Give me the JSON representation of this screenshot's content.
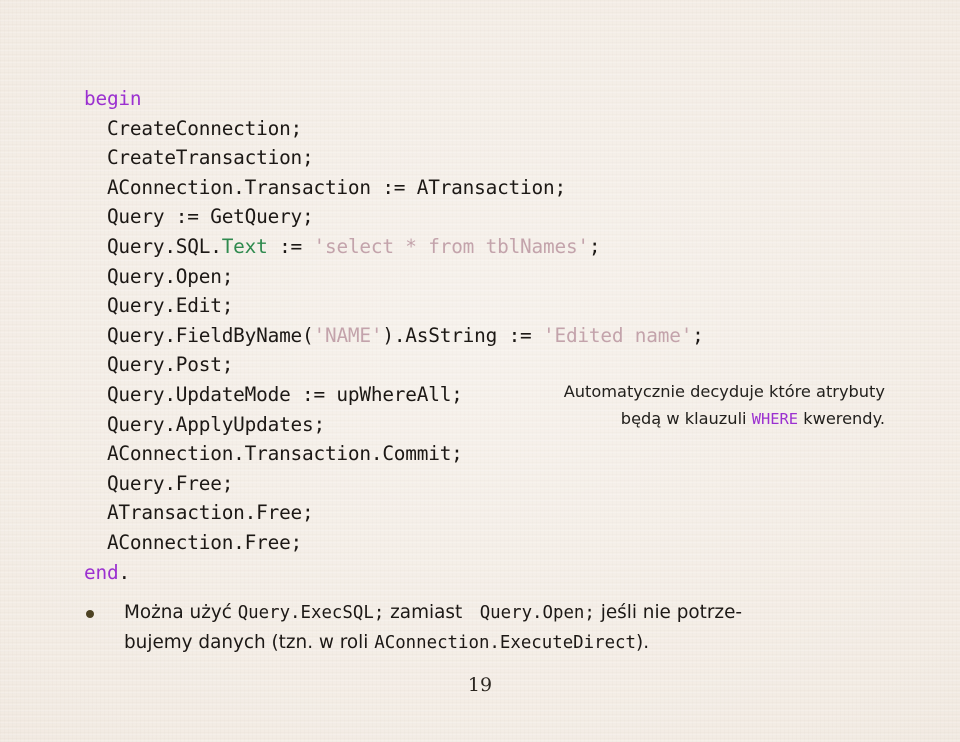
{
  "slide": {
    "background_color": "#f3ece4",
    "page_number": "19"
  },
  "colors": {
    "keyword": "#9b30d0",
    "property": "#2f8a4e",
    "string": "#c3a3ab",
    "text": "#1c1815",
    "bullet": "#4d4222"
  },
  "code": {
    "language": "pascal",
    "lines": [
      {
        "indent": 0,
        "tokens": [
          {
            "t": "begin",
            "c": "kw"
          }
        ]
      },
      {
        "indent": 1,
        "tokens": [
          {
            "t": "CreateConnection;",
            "c": "plain"
          }
        ]
      },
      {
        "indent": 1,
        "tokens": [
          {
            "t": "CreateTransaction;",
            "c": "plain"
          }
        ]
      },
      {
        "indent": 1,
        "tokens": [
          {
            "t": "AConnection.Transaction := ATransaction;",
            "c": "plain"
          }
        ]
      },
      {
        "indent": 1,
        "tokens": [
          {
            "t": "Query := GetQuery;",
            "c": "plain"
          }
        ]
      },
      {
        "indent": 1,
        "tokens": [
          {
            "t": "Query.SQL.",
            "c": "plain"
          },
          {
            "t": "Text",
            "c": "prop"
          },
          {
            "t": " := ",
            "c": "plain"
          },
          {
            "t": "'select * from tblNames'",
            "c": "str"
          },
          {
            "t": ";",
            "c": "plain"
          }
        ]
      },
      {
        "indent": 1,
        "tokens": [
          {
            "t": "Query.Open;",
            "c": "plain"
          }
        ]
      },
      {
        "indent": 1,
        "tokens": [
          {
            "t": "Query.Edit;",
            "c": "plain"
          }
        ]
      },
      {
        "indent": 1,
        "tokens": [
          {
            "t": "Query.FieldByName(",
            "c": "plain"
          },
          {
            "t": "'NAME'",
            "c": "str"
          },
          {
            "t": ").AsString := ",
            "c": "plain"
          },
          {
            "t": "'Edited name'",
            "c": "str"
          },
          {
            "t": ";",
            "c": "plain"
          }
        ]
      },
      {
        "indent": 1,
        "tokens": [
          {
            "t": "Query.Post;",
            "c": "plain"
          }
        ]
      },
      {
        "indent": 1,
        "tokens": [
          {
            "t": "Query.UpdateMode := upWhereAll;",
            "c": "plain"
          }
        ]
      },
      {
        "indent": 1,
        "tokens": [
          {
            "t": "Query.ApplyUpdates;",
            "c": "plain"
          }
        ]
      },
      {
        "indent": 1,
        "tokens": [
          {
            "t": "AConnection.Transaction.Commit;",
            "c": "plain"
          }
        ]
      },
      {
        "indent": 1,
        "tokens": [
          {
            "t": "Query.Free;",
            "c": "plain"
          }
        ]
      },
      {
        "indent": 1,
        "tokens": [
          {
            "t": "ATransaction.Free;",
            "c": "plain"
          }
        ]
      },
      {
        "indent": 1,
        "tokens": [
          {
            "t": "AConnection.Free;",
            "c": "plain"
          }
        ]
      },
      {
        "indent": 0,
        "tokens": [
          {
            "t": "end",
            "c": "kw"
          },
          {
            "t": ".",
            "c": "plain"
          }
        ]
      }
    ]
  },
  "annotation": {
    "line1": "Automatycznie decyduje które atrybuty",
    "line2_before": "będą w klauzuli ",
    "line2_keyword": "WHERE",
    "line2_after": " kwerendy."
  },
  "bullet": {
    "segments": [
      {
        "t": "Można użyć ",
        "m": false
      },
      {
        "t": "Query.ExecSQL;",
        "m": true
      },
      {
        "t": " zamiast   ",
        "m": false
      },
      {
        "t": "Query.Open;",
        "m": true
      },
      {
        "t": " jeśli nie potrze-\nbujemy danych (tzn. w roli ",
        "m": false
      },
      {
        "t": "AConnection.ExecuteDirect",
        "m": true
      },
      {
        "t": ").",
        "m": false
      }
    ]
  }
}
